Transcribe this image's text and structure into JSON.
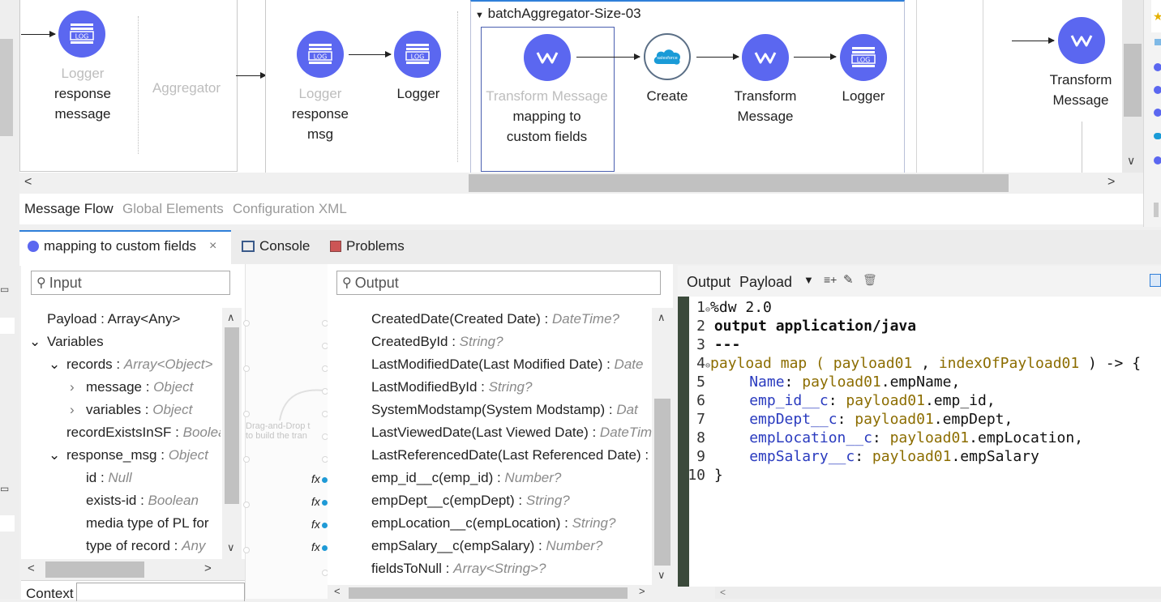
{
  "canvas": {
    "container_title": "batchAggregator-Size-03",
    "nodes": [
      {
        "dim": "Logger",
        "label1": "response",
        "label2": "message"
      },
      {
        "dim": "Aggregator"
      },
      {
        "dim": "Logger",
        "label1": "response",
        "label2": "msg"
      },
      {
        "label1": "Logger"
      },
      {
        "dim": "Transform Message",
        "label1": "mapping to",
        "label2": "custom fields"
      },
      {
        "label1": "Create"
      },
      {
        "label1": "Transform",
        "label2": "Message"
      },
      {
        "label1": "Logger"
      },
      {
        "label1": "Transform",
        "label2": "Message"
      }
    ],
    "log_text": "LOG",
    "sf_text": "salesforce"
  },
  "editor_tabs": {
    "message_flow": "Message Flow",
    "global_elements": "Global Elements",
    "configuration_xml": "Configuration XML"
  },
  "bottom_tabs": {
    "mapping": "mapping to custom fields",
    "console": "Console",
    "problems": "Problems"
  },
  "input_panel": {
    "search_placeholder": "Input",
    "rows": [
      {
        "name": "Payload",
        "sep": " : ",
        "type": "Array<Any>"
      },
      {
        "name": "Variables",
        "sep": "",
        "type": ""
      },
      {
        "name": "records",
        "sep": " : ",
        "type": "Array<Object>"
      },
      {
        "name": "message",
        "sep": " : ",
        "type": "Object"
      },
      {
        "name": "variables",
        "sep": " : ",
        "type": "Object"
      },
      {
        "name": "recordExistsInSF",
        "sep": " : ",
        "type": "Boolea"
      },
      {
        "name": "response_msg",
        "sep": " : ",
        "type": "Object"
      },
      {
        "name": "id",
        "sep": " : ",
        "type": "Null"
      },
      {
        "name": "exists-id",
        "sep": " : ",
        "type": "Boolean"
      },
      {
        "name": "media type of PL for",
        "sep": "",
        "type": ""
      },
      {
        "name": "type of record",
        "sep": " : ",
        "type": "Any"
      }
    ],
    "context_label": "Context"
  },
  "drop_hint": {
    "line1": "Drag-and-Drop t",
    "line2": "to build the tran"
  },
  "output_panel": {
    "search_placeholder": "Output",
    "rows": [
      {
        "name": "CreatedDate(Created Date)",
        "sep": " : ",
        "type": "DateTime?"
      },
      {
        "name": "CreatedById",
        "sep": " : ",
        "type": "String?"
      },
      {
        "name": "LastModifiedDate(Last Modified Date)",
        "sep": " : ",
        "type": "Date"
      },
      {
        "name": "LastModifiedById",
        "sep": " : ",
        "type": "String?"
      },
      {
        "name": "SystemModstamp(System Modstamp)",
        "sep": " : ",
        "type": "Dat"
      },
      {
        "name": "LastViewedDate(Last Viewed Date)",
        "sep": " : ",
        "type": "DateTim"
      },
      {
        "name": "LastReferencedDate(Last Referenced Date)",
        "sep": " : ",
        "type": "I"
      },
      {
        "name": "emp_id__c(emp_id)",
        "sep": " : ",
        "type": "Number?"
      },
      {
        "name": "empDept__c(empDept)",
        "sep": " : ",
        "type": "String?"
      },
      {
        "name": "empLocation__c(empLocation)",
        "sep": " : ",
        "type": "String?"
      },
      {
        "name": "empSalary__c(empSalary)",
        "sep": " : ",
        "type": "Number?"
      },
      {
        "name": "fieldsToNull",
        "sep": " : ",
        "type": "Array<String>?"
      }
    ],
    "fx_label": "fx"
  },
  "script_editor": {
    "header_left": "Output",
    "header_target": "Payload",
    "lines": [
      {
        "n": "1",
        "text": "%dw 2.0"
      },
      {
        "n": "2",
        "text": "output application/java"
      },
      {
        "n": "3",
        "text": "---"
      },
      {
        "n": "4",
        "a": "payload map ( ",
        "b": "payload01",
        "c": " , ",
        "d": "indexOfPayload01",
        "e": " ) -> {"
      },
      {
        "n": "5",
        "f": "Name",
        "g": ": ",
        "h": "payload01",
        "i": ".empName,"
      },
      {
        "n": "6",
        "f": "emp_id__c",
        "g": ": ",
        "h": "payload01",
        "i": ".emp_id,"
      },
      {
        "n": "7",
        "f": "empDept__c",
        "g": ": ",
        "h": "payload01",
        "i": ".empDept,"
      },
      {
        "n": "8",
        "f": "empLocation__c",
        "g": ": ",
        "h": "payload01",
        "i": ".empLocation,"
      },
      {
        "n": "9",
        "f": "empSalary__c",
        "g": ": ",
        "h": "payload01",
        "i": ".empSalary"
      },
      {
        "n": "10",
        "text": "}"
      }
    ]
  },
  "colors": {
    "accent": "#5b67f0",
    "mapped_dot": "#1f9ad6",
    "code_var": "#8c6d00",
    "code_field": "#2a3bbf"
  }
}
